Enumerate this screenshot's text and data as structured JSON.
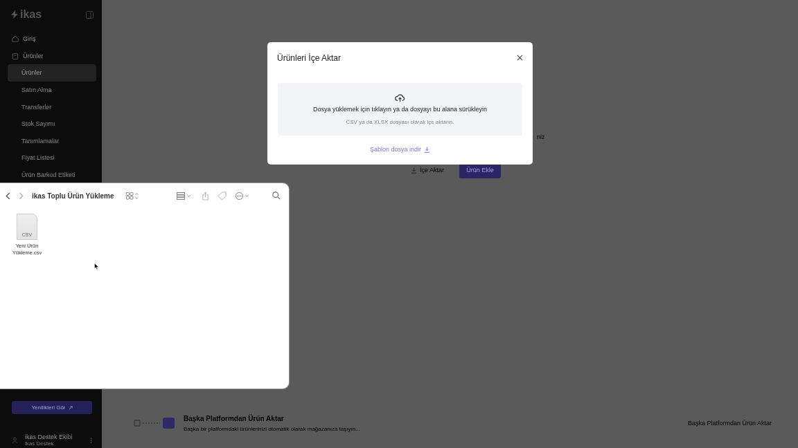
{
  "sidebar": {
    "logo": "ikas",
    "items": [
      {
        "label": "Giriş"
      },
      {
        "label": "Ürünler",
        "children": [
          {
            "label": "Ürünler",
            "selected": true
          },
          {
            "label": "Satın Alma",
            "selected": false
          },
          {
            "label": "Transferler",
            "selected": false
          },
          {
            "label": "Stok Sayımı",
            "selected": false
          },
          {
            "label": "Tanımlamalar",
            "selected": false
          },
          {
            "label": "Fiyat Listesi",
            "selected": false
          },
          {
            "label": "Ürün Barkod Etiketi",
            "selected": false
          }
        ]
      }
    ],
    "whats_new_button": "Yenilikleri Gör",
    "user": {
      "name": "ikas Destek Ekibi",
      "store": "ikas Destek"
    }
  },
  "main": {
    "subtitle_fragment": "niz",
    "import_button": "İçe Aktar",
    "add_button": "Ürün Ekle",
    "migration": {
      "title": "Başka Platformdan Ürün Aktar",
      "description": "Başka bir platformdaki ürünlerinizi otomatik olarak mağazanıza taşıyın...",
      "button": "Başka Platformdan Ürün Aktar"
    }
  },
  "modal": {
    "title": "Ürünleri İçe Aktar",
    "dropzone": {
      "prompt": "Dosya yüklemek için tıklayın ya da dosyayı bu alana sürükleyin",
      "hint": "CSV ya da XLSX dosyası olarak içe aktarın."
    },
    "template_link": "Şablon dosya indir"
  },
  "finder": {
    "title": "ikas Toplu Ürün Yükleme",
    "files": [
      {
        "name": "Yeni Ürün Yükleme.csv",
        "type": "CSV"
      }
    ]
  }
}
